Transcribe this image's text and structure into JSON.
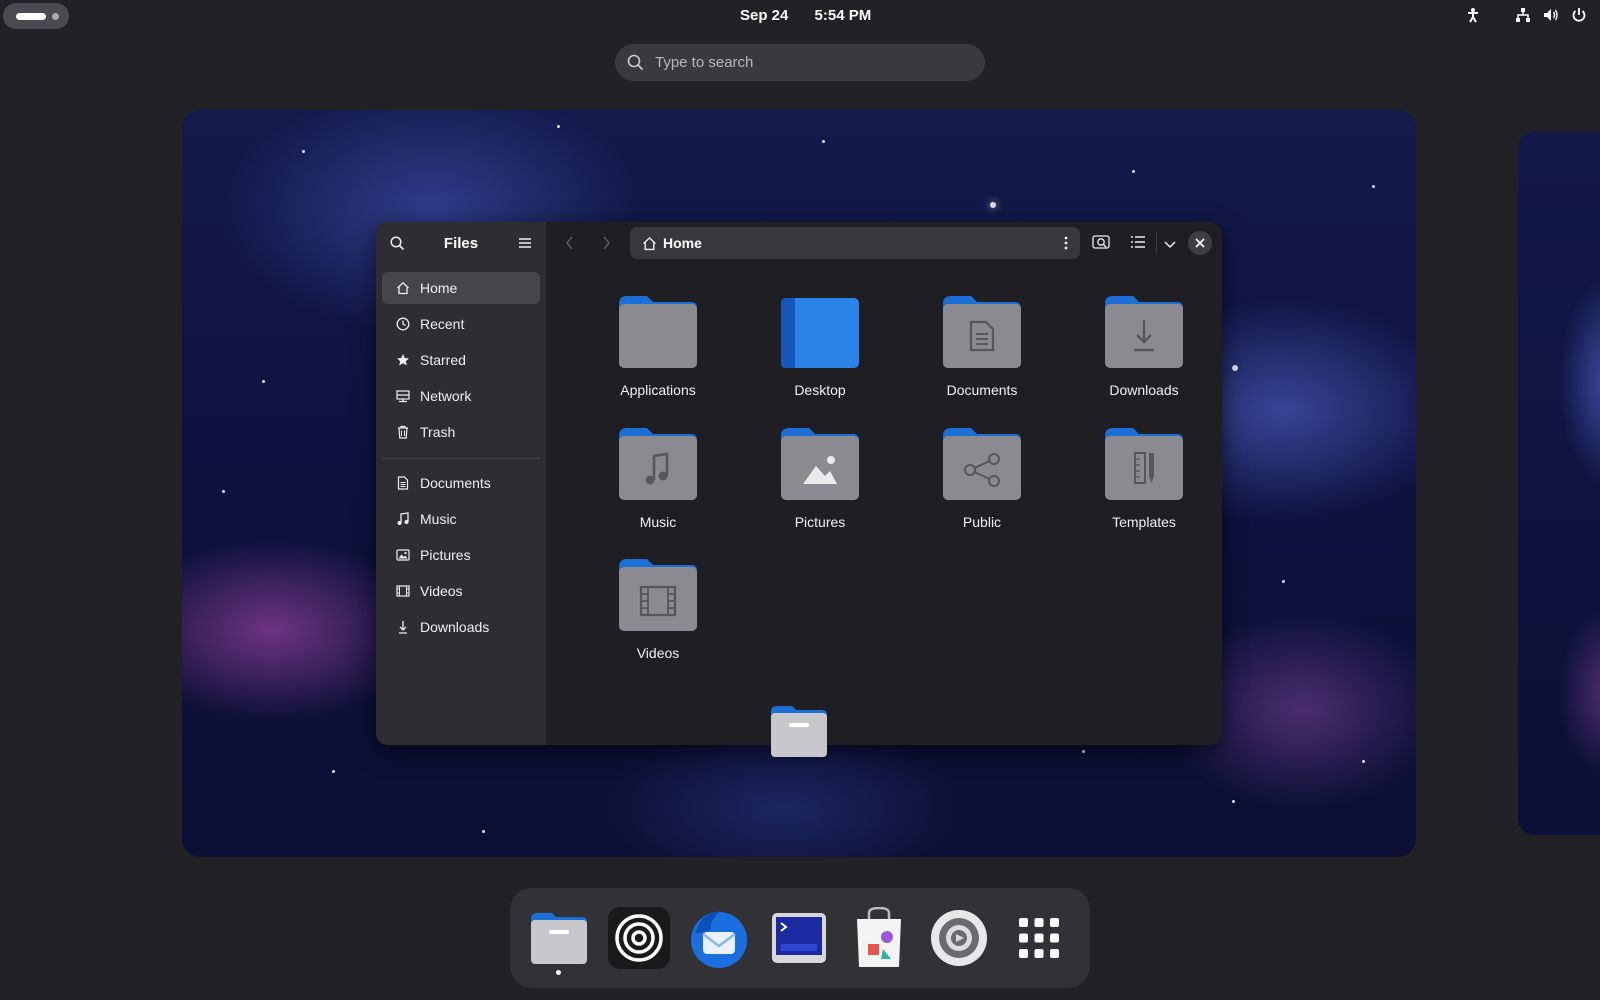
{
  "topbar": {
    "date": "Sep 24",
    "time": "5:54 PM",
    "tray_icons": [
      "accessibility-icon",
      "network-wired-icon",
      "volume-icon",
      "power-icon"
    ]
  },
  "search": {
    "placeholder": "Type to search"
  },
  "window": {
    "app_title": "Files",
    "path_label": "Home",
    "sidebar_places": [
      {
        "label": "Home",
        "icon": "home-icon",
        "active": true
      },
      {
        "label": "Recent",
        "icon": "clock-icon"
      },
      {
        "label": "Starred",
        "icon": "star-icon"
      },
      {
        "label": "Network",
        "icon": "network-icon"
      },
      {
        "label": "Trash",
        "icon": "trash-icon"
      }
    ],
    "sidebar_bookmarks": [
      {
        "label": "Documents",
        "icon": "document-icon"
      },
      {
        "label": "Music",
        "icon": "music-icon"
      },
      {
        "label": "Pictures",
        "icon": "picture-icon"
      },
      {
        "label": "Videos",
        "icon": "film-icon"
      },
      {
        "label": "Downloads",
        "icon": "download-icon"
      }
    ],
    "folders": [
      {
        "label": "Applications",
        "icon": "folder-icon"
      },
      {
        "label": "Desktop",
        "icon": "desktop-folder-icon"
      },
      {
        "label": "Documents",
        "icon": "documents-folder-icon"
      },
      {
        "label": "Downloads",
        "icon": "downloads-folder-icon"
      },
      {
        "label": "Music",
        "icon": "music-folder-icon"
      },
      {
        "label": "Pictures",
        "icon": "pictures-folder-icon"
      },
      {
        "label": "Public",
        "icon": "public-folder-icon"
      },
      {
        "label": "Templates",
        "icon": "templates-folder-icon"
      },
      {
        "label": "Videos",
        "icon": "videos-folder-icon"
      }
    ]
  },
  "dock": {
    "apps": [
      "files-app-icon",
      "podcasts-app-icon",
      "thunderbird-app-icon",
      "terminal-app-icon",
      "software-app-icon",
      "settings-app-icon",
      "app-grid-icon"
    ]
  },
  "colors": {
    "folder_tab": "#1c6fd6",
    "folder_body": "#8a8a90",
    "accent": "#3584e4"
  }
}
